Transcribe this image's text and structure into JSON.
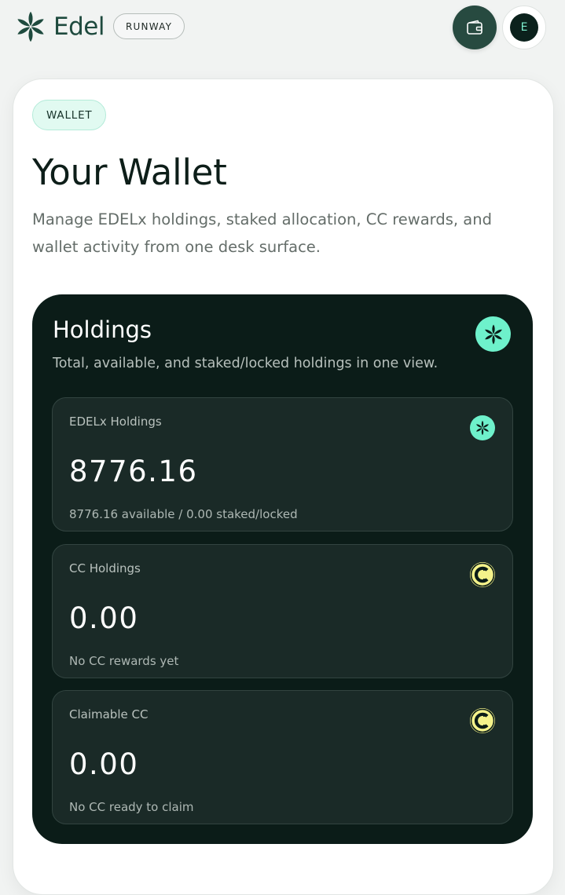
{
  "brand": {
    "name": "Edel",
    "icon": "edel-flower-icon",
    "color": "#1e4a3e"
  },
  "header": {
    "environment_badge": "RUNWAY",
    "wallet_button_icon": "wallet-icon",
    "avatar_initial": "E"
  },
  "page": {
    "section_badge": "WALLET",
    "title": "Your Wallet",
    "description": "Manage EDELx holdings, staked allocation, CC rewards, and wallet activity from one desk surface."
  },
  "holdings": {
    "title": "Holdings",
    "subtitle": "Total, available, and staked/locked holdings in one view.",
    "badge_icon": "edel-flower-icon",
    "cards": [
      {
        "label": "EDELx Holdings",
        "value": "8776.16",
        "note": "8776.16 available / 0.00 staked/locked",
        "icon": "edel-flower-icon"
      },
      {
        "label": "CC Holdings",
        "value": "0.00",
        "note": "No CC rewards yet",
        "icon": "cc-coin-icon"
      },
      {
        "label": "Claimable CC",
        "value": "0.00",
        "note": "No CC ready to claim",
        "icon": "cc-coin-icon"
      }
    ]
  },
  "colors": {
    "accent_mint": "#6ef1cb",
    "accent_yellow": "#f4f28a",
    "panel_dark": "#0b1c18",
    "card_dark": "#1a2a27",
    "button_dark_green": "#274a40"
  }
}
